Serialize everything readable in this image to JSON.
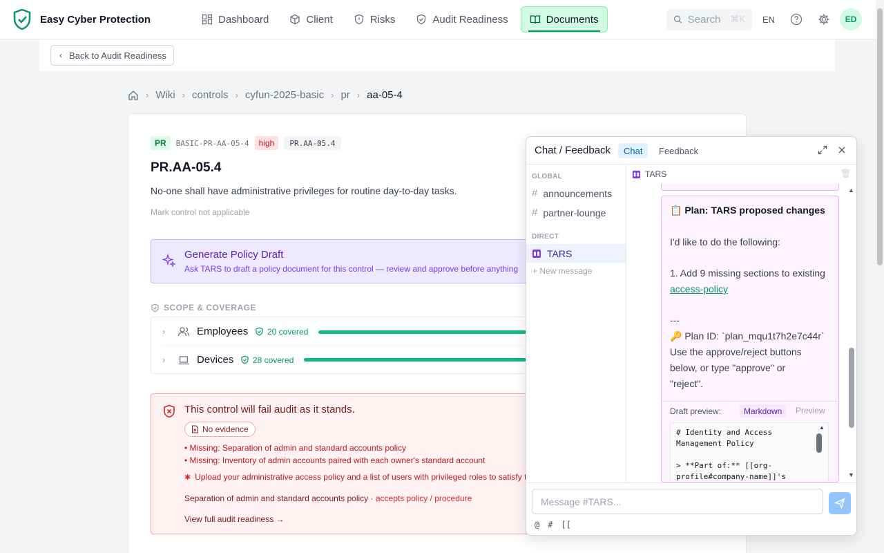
{
  "app": {
    "title": "Easy Cyber Protection"
  },
  "nav": {
    "items": [
      {
        "label": "Dashboard"
      },
      {
        "label": "Client"
      },
      {
        "label": "Risks"
      },
      {
        "label": "Audit Readiness"
      },
      {
        "label": "Documents",
        "active": true
      }
    ],
    "search_placeholder": "Search",
    "search_shortcut": "⌘K",
    "lang": "EN",
    "avatar_initials": "ED"
  },
  "back_button": "Back to Audit Readiness",
  "breadcrumb": [
    "Wiki",
    "controls",
    "cyfun-2025-basic",
    "pr",
    "aa-05-4"
  ],
  "control": {
    "family_tag": "PR",
    "control_id": "BASIC-PR-AA-05-4",
    "severity": "high",
    "code": "PR.AA-05.4",
    "title": "PR.AA-05.4",
    "description": "No-one shall have administrative privileges for routine day-to-day tasks.",
    "mark_na": "Mark control not applicable"
  },
  "generate": {
    "title": "Generate Policy Draft",
    "subtitle": "Ask TARS to draft a policy document for this control — review and approve before anything"
  },
  "scope": {
    "heading": "SCOPE & COVERAGE",
    "rows": [
      {
        "label": "Employees",
        "covered": "20 covered",
        "fill": 1.0
      },
      {
        "label": "Devices",
        "covered": "28 covered",
        "fill": 1.0
      }
    ]
  },
  "fail": {
    "title": "This control will fail audit as it stands.",
    "badge": "No evidence",
    "missing": [
      "• Missing: Separation of admin and standard accounts policy",
      "• Missing: Inventory of admin accounts paired with each owner's standard account"
    ],
    "upload": "Upload your administrative access policy and a list of users with privileged roles to satisfy the",
    "requirement": "Separation of admin and standard accounts policy",
    "requirement_note": "· accepts policy / procedure",
    "view_link": "View full audit readiness →"
  },
  "chat": {
    "title": "Chat / Feedback",
    "tabs": [
      {
        "label": "Chat",
        "active": true
      },
      {
        "label": "Feedback"
      }
    ],
    "sections": {
      "global": "GLOBAL",
      "direct": "DIRECT"
    },
    "channels": [
      "announcements",
      "partner-lounge"
    ],
    "direct": [
      "TARS"
    ],
    "new_message": "+ New message",
    "conversation": "TARS",
    "message": {
      "title": "📋 Plan: TARS proposed changes",
      "intro": "I'd like to do the following:",
      "step_prefix": "1. Add 9 missing sections to existing",
      "step_link": "access-policy",
      "hr": "---",
      "plan_id": "🔑 Plan ID: `plan_mqu1t7h2e7c44r`",
      "instr1": "Use the approve/reject buttons",
      "instr2": "below, or type \"approve\" or",
      "instr3": "\"reject\"."
    },
    "draft": {
      "label": "Draft preview:",
      "markdown": "Markdown",
      "preview": "Preview",
      "code": "# Identity and Access\nManagement Policy\n\n> **Part of:** [[org-\nprofile#company-name]]'s"
    },
    "input_placeholder": "Message #TARS...",
    "tools": [
      "@",
      "#",
      "[["
    ]
  }
}
